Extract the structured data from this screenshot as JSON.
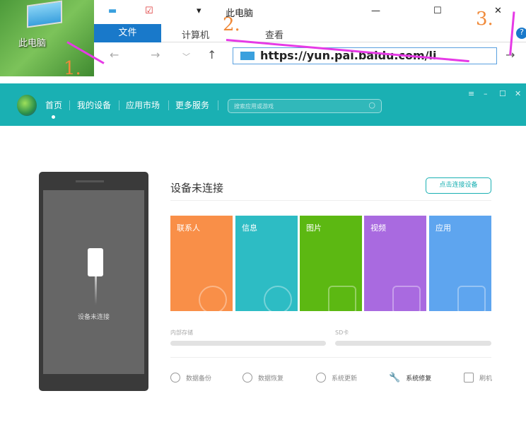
{
  "desktop": {
    "icon_label": "此电脑"
  },
  "explorer": {
    "title": "此电脑",
    "tabs": [
      "文件",
      "计算机",
      "查看"
    ],
    "address": "https://yun.pai.baidu.com/li",
    "window_controls": [
      "minimize",
      "maximize",
      "close"
    ],
    "annotations": [
      "1.",
      "2.",
      "3."
    ]
  },
  "app": {
    "nav": [
      "首页",
      "我的设备",
      "应用市场",
      "更多服务"
    ],
    "search_placeholder": "搜索应用或游戏",
    "window_controls": [
      "≡",
      "–",
      "☐",
      "✕"
    ],
    "phone_status": "设备未连接",
    "title": "设备未连接",
    "connect_button": "点击连接设备",
    "tiles": [
      {
        "label": "联系人",
        "color": "#f98f48"
      },
      {
        "label": "信息",
        "color": "#2dbcc4"
      },
      {
        "label": "图片",
        "color": "#5cb812"
      },
      {
        "label": "视频",
        "color": "#a96ae0"
      },
      {
        "label": "应用",
        "color": "#5ea5ef"
      }
    ],
    "storage": [
      {
        "label": "内部存储"
      },
      {
        "label": "SD卡"
      }
    ],
    "tools": [
      "数据备份",
      "数据恢复",
      "系统更新",
      "系统修复",
      "刷机"
    ]
  },
  "colors": {
    "accent": "#1ab0b3",
    "arrow": "#e63ae6"
  }
}
